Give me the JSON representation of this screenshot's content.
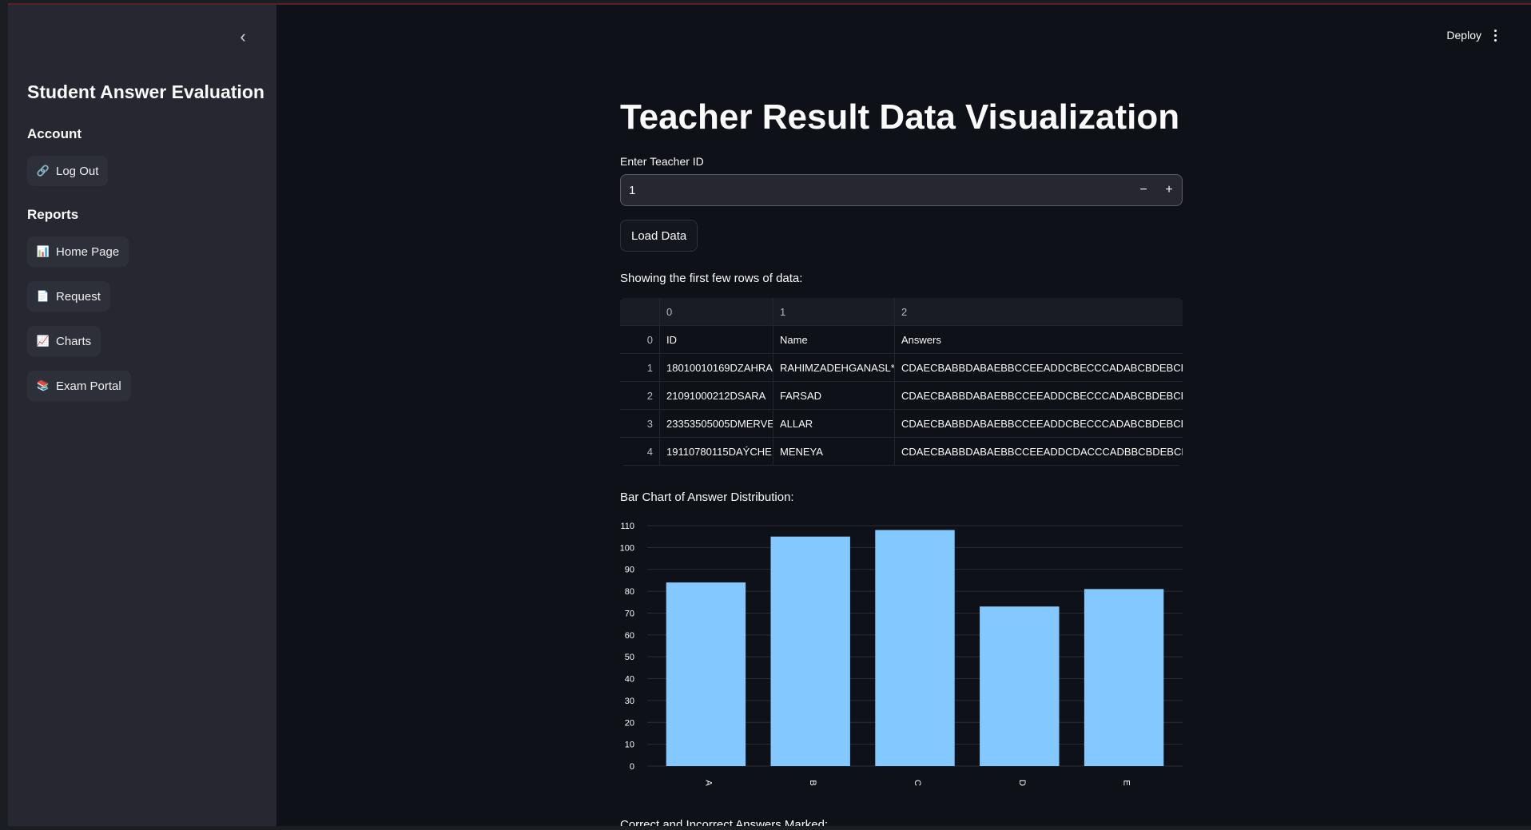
{
  "sidebar": {
    "title": "Student Answer Evaluation",
    "account_label": "Account",
    "logout_label": "Log Out",
    "reports_label": "Reports",
    "items": [
      {
        "label": "Home Page",
        "icon": "bar-chart-icon"
      },
      {
        "label": "Request",
        "icon": "document-icon"
      },
      {
        "label": "Charts",
        "icon": "line-chart-icon"
      },
      {
        "label": "Exam Portal",
        "icon": "books-icon"
      }
    ]
  },
  "topbar": {
    "deploy_label": "Deploy"
  },
  "main": {
    "title": "Teacher Result Data Visualization",
    "teacher_id_label": "Enter Teacher ID",
    "teacher_id_value": "1",
    "load_button": "Load Data",
    "rows_caption": "Showing the first few rows of data:",
    "chart_caption": "Bar Chart of Answer Distribution:",
    "next_caption": "Correct and Incorrect Answers Marked:"
  },
  "table": {
    "columns": [
      "0",
      "1",
      "2"
    ],
    "rows": [
      {
        "index": "0",
        "cells": [
          "ID",
          "Name",
          "Answers"
        ]
      },
      {
        "index": "1",
        "cells": [
          "18010010169DZAHRA",
          "RAHIMZADEHGANASL**",
          "CDAECBABBDABAEBBCCEEADDCBECCCADABCBDEBCEDACC"
        ]
      },
      {
        "index": "2",
        "cells": [
          "21091000212DSARA",
          "FARSAD",
          "CDAECBABBDABAEBBCCEEADDCBECCCADABCBDEBCEDACC"
        ]
      },
      {
        "index": "3",
        "cells": [
          "23353505005DMERVE",
          "ALLAR",
          "CDAECBABBDABAEBBCCEEADDCBECCCADABCBDEBCEDACC"
        ]
      },
      {
        "index": "4",
        "cells": [
          "19110780115DAÝCHE",
          "MENEYA",
          "CDAECBABBDABAEBBCCEEADDCDACCCADBBCBDEBCEDACC"
        ]
      }
    ]
  },
  "chart_data": {
    "type": "bar",
    "categories": [
      "A",
      "B",
      "C",
      "D",
      "E"
    ],
    "values": [
      84,
      105,
      108,
      73,
      81
    ],
    "title": "",
    "xlabel": "",
    "ylabel": "",
    "ylim": [
      0,
      110
    ],
    "yticks": [
      0,
      10,
      20,
      30,
      40,
      50,
      60,
      70,
      80,
      90,
      100,
      110
    ],
    "grid": true,
    "bar_color": "#83c9ff",
    "grid_color": "#2a2d35"
  },
  "colors": {
    "background": "#0e1117",
    "sidebar": "#262730",
    "text": "#fafafa"
  }
}
